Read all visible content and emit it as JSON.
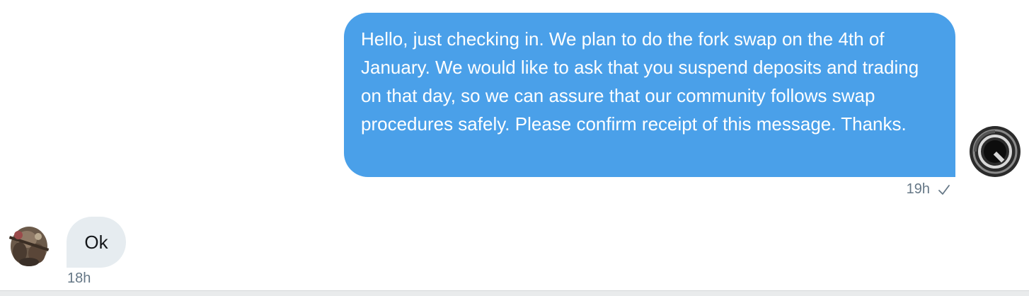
{
  "conversation": {
    "sent_message": {
      "text": "Hello, just checking in. We plan to do the fork swap on the 4th of January. We would like to ask that you suspend deposits and trading on that day, so we can assure that our community follows swap procedures safely. Please confirm receipt of this message. Thanks.",
      "timestamp": "19h",
      "status_icon": "checkmark-icon",
      "bubble_color": "#4aa0e9"
    },
    "received_message": {
      "text": "Ok",
      "timestamp": "18h",
      "bubble_color": "#e6ecf0"
    }
  }
}
